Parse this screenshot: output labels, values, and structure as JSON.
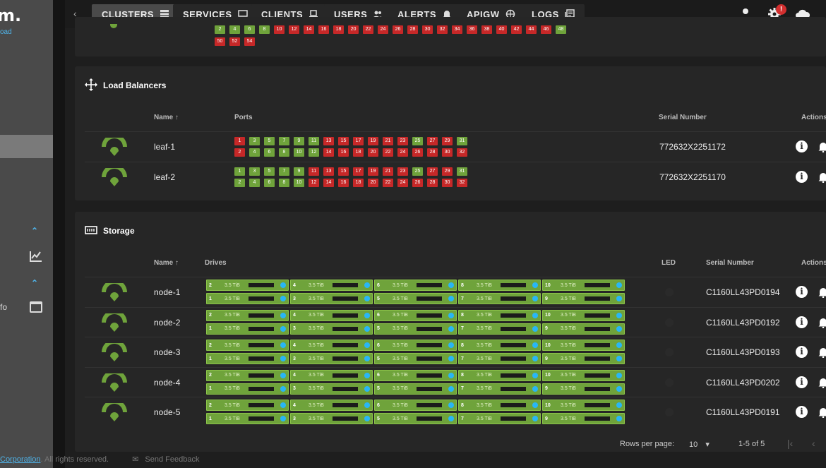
{
  "sidebar": {
    "logo": "m.",
    "sublogo": "oad",
    "fo_label": "fo"
  },
  "nav": {
    "tabs": [
      {
        "label": "CLUSTERS",
        "icon": "server-icon"
      },
      {
        "label": "SERVICES",
        "icon": "monitor-icon"
      },
      {
        "label": "CLIENTS",
        "icon": "laptop-icon"
      },
      {
        "label": "USERS",
        "icon": "users-icon"
      },
      {
        "label": "ALERTS",
        "icon": "bell-icon"
      },
      {
        "label": "APIGW",
        "icon": "globe-icon"
      },
      {
        "label": "LOGS",
        "icon": "logs-icon"
      }
    ],
    "settings_badge": "!"
  },
  "top_ports": {
    "row1": [
      "2",
      "4",
      "6",
      "8",
      "10",
      "12",
      "14",
      "16",
      "18",
      "20",
      "22",
      "24",
      "26",
      "28",
      "30",
      "32",
      "34",
      "36",
      "38",
      "40",
      "42",
      "44",
      "46",
      "48"
    ],
    "row2": [
      "50",
      "52",
      "54"
    ]
  },
  "load_balancers": {
    "title": "Load Balancers",
    "headers": {
      "name": "Name",
      "ports": "Ports",
      "serial": "Serial Number",
      "actions": "Actions"
    },
    "rows": [
      {
        "name": "leaf-1",
        "serial": "772632X2251172",
        "ports_top": [
          [
            "1",
            "down"
          ],
          [
            "3",
            "up"
          ],
          [
            "5",
            "up"
          ],
          [
            "7",
            "up"
          ],
          [
            "9",
            "up"
          ],
          [
            "11",
            "up"
          ],
          [
            "13",
            "down"
          ],
          [
            "15",
            "down"
          ],
          [
            "17",
            "down"
          ],
          [
            "19",
            "down"
          ],
          [
            "21",
            "down"
          ],
          [
            "23",
            "down"
          ],
          [
            "25",
            "up"
          ],
          [
            "27",
            "down"
          ],
          [
            "29",
            "down"
          ],
          [
            "31",
            "up"
          ]
        ],
        "ports_bottom": [
          [
            "2",
            "down"
          ],
          [
            "4",
            "up"
          ],
          [
            "6",
            "up"
          ],
          [
            "8",
            "up"
          ],
          [
            "10",
            "up"
          ],
          [
            "12",
            "up"
          ],
          [
            "14",
            "down"
          ],
          [
            "16",
            "down"
          ],
          [
            "18",
            "down"
          ],
          [
            "20",
            "down"
          ],
          [
            "22",
            "down"
          ],
          [
            "24",
            "down"
          ],
          [
            "26",
            "down"
          ],
          [
            "28",
            "down"
          ],
          [
            "30",
            "down"
          ],
          [
            "32",
            "down"
          ]
        ]
      },
      {
        "name": "leaf-2",
        "serial": "772632X2251170",
        "ports_top": [
          [
            "1",
            "up"
          ],
          [
            "3",
            "up"
          ],
          [
            "5",
            "up"
          ],
          [
            "7",
            "up"
          ],
          [
            "9",
            "up"
          ],
          [
            "11",
            "down"
          ],
          [
            "13",
            "down"
          ],
          [
            "15",
            "down"
          ],
          [
            "17",
            "down"
          ],
          [
            "19",
            "down"
          ],
          [
            "21",
            "down"
          ],
          [
            "23",
            "down"
          ],
          [
            "25",
            "up"
          ],
          [
            "27",
            "down"
          ],
          [
            "29",
            "down"
          ],
          [
            "31",
            "up"
          ]
        ],
        "ports_bottom": [
          [
            "2",
            "up"
          ],
          [
            "4",
            "up"
          ],
          [
            "6",
            "up"
          ],
          [
            "8",
            "up"
          ],
          [
            "10",
            "up"
          ],
          [
            "12",
            "down"
          ],
          [
            "14",
            "down"
          ],
          [
            "16",
            "down"
          ],
          [
            "18",
            "down"
          ],
          [
            "20",
            "down"
          ],
          [
            "22",
            "down"
          ],
          [
            "24",
            "down"
          ],
          [
            "26",
            "down"
          ],
          [
            "28",
            "down"
          ],
          [
            "30",
            "down"
          ],
          [
            "32",
            "down"
          ]
        ]
      }
    ]
  },
  "storage": {
    "title": "Storage",
    "headers": {
      "name": "Name",
      "drives": "Drives",
      "led": "LED",
      "serial": "Serial Number",
      "actions": "Actions"
    },
    "drive_capacity": "3.5 TiB",
    "drive_top": [
      "2",
      "4",
      "6",
      "8",
      "10"
    ],
    "drive_bottom": [
      "1",
      "3",
      "5",
      "7",
      "9"
    ],
    "rows": [
      {
        "name": "node-1",
        "serial": "C1160LL43PD0194"
      },
      {
        "name": "node-2",
        "serial": "C1160LL43PD0192"
      },
      {
        "name": "node-3",
        "serial": "C1160LL43PD0193"
      },
      {
        "name": "node-4",
        "serial": "C1160LL43PD0202"
      },
      {
        "name": "node-5",
        "serial": "C1160LL43PD0191"
      }
    ]
  },
  "pagination": {
    "rows_per_page_label": "Rows per page:",
    "rows_per_page": "10",
    "range": "1-5 of 5"
  },
  "footer": {
    "corp": "Corporation",
    "rights": ". All rights reserved.",
    "feedback": "Send Feedback"
  },
  "colors": {
    "up": "#6fa33b",
    "down": "#c62828",
    "accent": "#4fb3e8"
  }
}
